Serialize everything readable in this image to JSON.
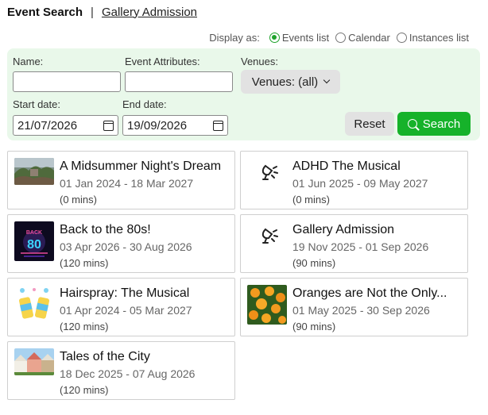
{
  "header": {
    "active_tab": "Event Search",
    "separator": "|",
    "link_tab": "Gallery Admission"
  },
  "display_as": {
    "label": "Display as:",
    "options": [
      {
        "label": "Events list",
        "selected": true
      },
      {
        "label": "Calendar",
        "selected": false
      },
      {
        "label": "Instances list",
        "selected": false
      }
    ]
  },
  "filters": {
    "name_label": "Name:",
    "name_value": "",
    "attributes_label": "Event Attributes:",
    "attributes_value": "",
    "venues_label": "Venues:",
    "venues_value": "Venues: (all)",
    "start_label": "Start date:",
    "start_value": "21/07/2026",
    "end_label": "End date:",
    "end_value": "19/09/2026",
    "reset_label": "Reset",
    "search_label": "Search"
  },
  "events": [
    {
      "title": "A Midsummer Night's Dream",
      "dates": "01 Jan 2024 - 18 Mar 2027",
      "duration": "(0 mins)",
      "thumb": "forest-photo"
    },
    {
      "title": "ADHD The Musical",
      "dates": "01 Jun 2025 - 09 May 2027",
      "duration": "(0 mins)",
      "thumb": "spotlight-icon"
    },
    {
      "title": "Back to the 80s!",
      "dates": "03 Apr 2026 - 30 Aug 2026",
      "duration": "(120 mins)",
      "thumb": "retro-80s-poster"
    },
    {
      "title": "Gallery Admission",
      "dates": "19 Nov 2025 - 01 Sep 2026",
      "duration": "(90 mins)",
      "thumb": "spotlight-icon"
    },
    {
      "title": "Hairspray: The Musical",
      "dates": "01 Apr 2024 - 05 Mar 2027",
      "duration": "(120 mins)",
      "thumb": "hairspray-cans"
    },
    {
      "title": "Oranges are Not the Only...",
      "dates": "01 May 2025 - 30 Sep 2026",
      "duration": "(90 mins)",
      "thumb": "oranges-photo"
    },
    {
      "title": "Tales of the City",
      "dates": "18 Dec 2025 - 07 Aug 2026",
      "duration": "(120 mins)",
      "thumb": "houses-photo"
    }
  ],
  "colors": {
    "accent": "#16b22a",
    "filter_bg": "#e9f8ea"
  }
}
